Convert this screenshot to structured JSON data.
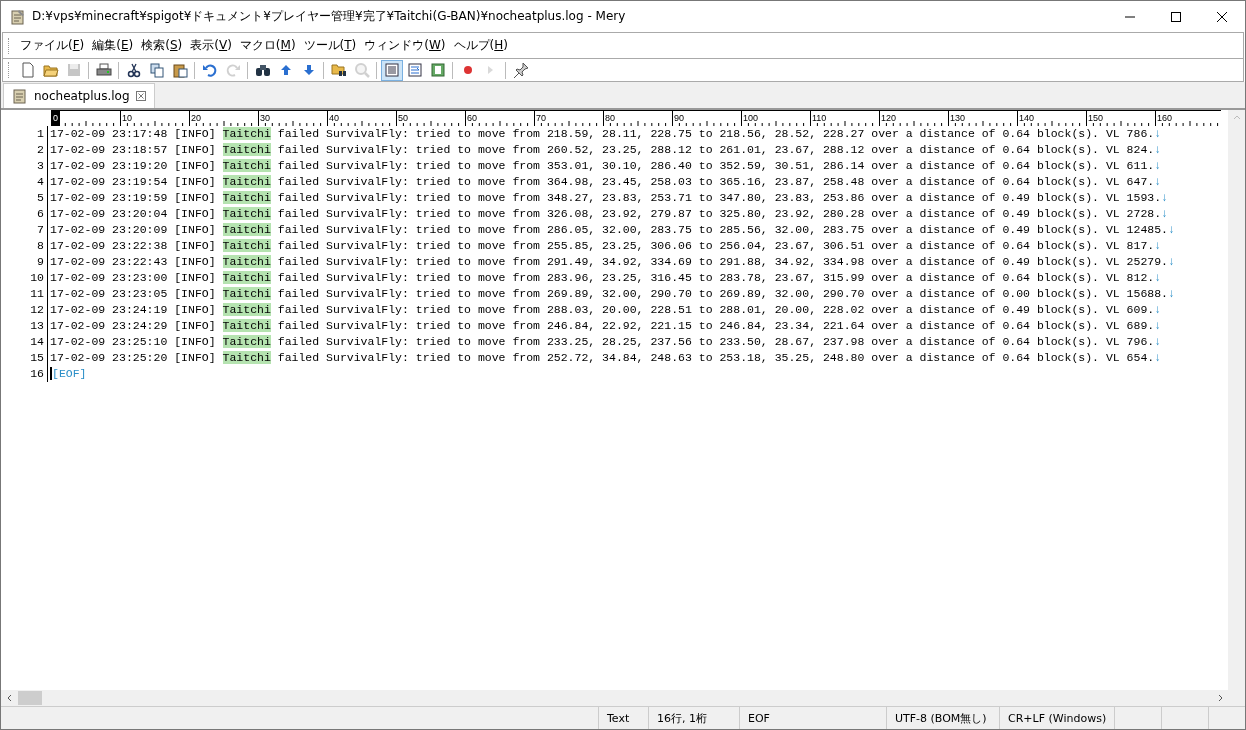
{
  "window": {
    "title": "D:¥vps¥minecraft¥spigot¥ドキュメント¥プレイヤー管理¥完了¥Taitchi(G-BAN)¥nocheatplus.log - Mery"
  },
  "menu": [
    "ファイル(F)",
    "編集(E)",
    "検索(S)",
    "表示(V)",
    "マクロ(M)",
    "ツール(T)",
    "ウィンドウ(W)",
    "ヘルプ(H)"
  ],
  "toolbar": [
    {
      "kind": "new",
      "disabled": false,
      "selected": false
    },
    {
      "kind": "open",
      "disabled": false,
      "selected": false
    },
    {
      "kind": "save",
      "disabled": true,
      "selected": false
    },
    {
      "kind": "separator"
    },
    {
      "kind": "print",
      "disabled": false,
      "selected": false
    },
    {
      "kind": "separator"
    },
    {
      "kind": "cut",
      "disabled": false,
      "selected": false
    },
    {
      "kind": "copy",
      "disabled": false,
      "selected": false
    },
    {
      "kind": "paste",
      "disabled": false,
      "selected": false
    },
    {
      "kind": "separator"
    },
    {
      "kind": "undo",
      "disabled": false,
      "selected": false
    },
    {
      "kind": "redo",
      "disabled": true,
      "selected": false
    },
    {
      "kind": "separator"
    },
    {
      "kind": "find",
      "disabled": false,
      "selected": false
    },
    {
      "kind": "up",
      "disabled": false,
      "selected": false
    },
    {
      "kind": "down",
      "disabled": false,
      "selected": false
    },
    {
      "kind": "separator"
    },
    {
      "kind": "findfiles",
      "disabled": false,
      "selected": false
    },
    {
      "kind": "magnifier",
      "disabled": true,
      "selected": false
    },
    {
      "kind": "separator"
    },
    {
      "kind": "wrapnone",
      "disabled": false,
      "selected": true
    },
    {
      "kind": "wrapwindow",
      "disabled": false,
      "selected": false
    },
    {
      "kind": "wrapcolumn",
      "disabled": false,
      "selected": false
    },
    {
      "kind": "separator"
    },
    {
      "kind": "record",
      "disabled": false,
      "selected": false
    },
    {
      "kind": "play",
      "disabled": true,
      "selected": false
    },
    {
      "kind": "separator"
    },
    {
      "kind": "pin",
      "disabled": false,
      "selected": false
    }
  ],
  "tabs": [
    {
      "label": "nocheatplus.log",
      "selected": true
    }
  ],
  "ruler": [
    "0",
    "10",
    "20",
    "30",
    "40",
    "50",
    "60",
    "70",
    "80",
    "90",
    "100",
    "110",
    "120",
    "130",
    "140",
    "150",
    "160"
  ],
  "lines": [
    {
      "number": "1",
      "head": "17-02-09 23:17:48 [INFO]",
      "match": "Taitchi",
      "rest": "failed SurvivalFly: tried to move from 218.59, 28.11, 228.75 to 218.56, 28.52, 228.27 over a distance of 0.64 block(s). VL 786.",
      "eol": "↓"
    },
    {
      "number": "2",
      "head": "17-02-09 23:18:57 [INFO]",
      "match": "Taitchi",
      "rest": "failed SurvivalFly: tried to move from 260.52, 23.25, 288.12 to 261.01, 23.67, 288.12 over a distance of 0.64 block(s). VL 824.",
      "eol": "↓"
    },
    {
      "number": "3",
      "head": "17-02-09 23:19:20 [INFO]",
      "match": "Taitchi",
      "rest": "failed SurvivalFly: tried to move from 353.01, 30.10, 286.40 to 352.59, 30.51, 286.14 over a distance of 0.64 block(s). VL 611.",
      "eol": "↓"
    },
    {
      "number": "4",
      "head": "17-02-09 23:19:54 [INFO]",
      "match": "Taitchi",
      "rest": "failed SurvivalFly: tried to move from 364.98, 23.45, 258.03 to 365.16, 23.87, 258.48 over a distance of 0.64 block(s). VL 647.",
      "eol": "↓"
    },
    {
      "number": "5",
      "head": "17-02-09 23:19:59 [INFO]",
      "match": "Taitchi",
      "rest": "failed SurvivalFly: tried to move from 348.27, 23.83, 253.71 to 347.80, 23.83, 253.86 over a distance of 0.49 block(s). VL 1593.",
      "eol": "↓"
    },
    {
      "number": "6",
      "head": "17-02-09 23:20:04 [INFO]",
      "match": "Taitchi",
      "rest": "failed SurvivalFly: tried to move from 326.08, 23.92, 279.87 to 325.80, 23.92, 280.28 over a distance of 0.49 block(s). VL 2728.",
      "eol": "↓"
    },
    {
      "number": "7",
      "head": "17-02-09 23:20:09 [INFO]",
      "match": "Taitchi",
      "rest": "failed SurvivalFly: tried to move from 286.05, 32.00, 283.75 to 285.56, 32.00, 283.75 over a distance of 0.49 block(s). VL 12485.",
      "eol": "↓"
    },
    {
      "number": "8",
      "head": "17-02-09 23:22:38 [INFO]",
      "match": "Taitchi",
      "rest": "failed SurvivalFly: tried to move from 255.85, 23.25, 306.06 to 256.04, 23.67, 306.51 over a distance of 0.64 block(s). VL 817.",
      "eol": "↓"
    },
    {
      "number": "9",
      "head": "17-02-09 23:22:43 [INFO]",
      "match": "Taitchi",
      "rest": "failed SurvivalFly: tried to move from 291.49, 34.92, 334.69 to 291.88, 34.92, 334.98 over a distance of 0.49 block(s). VL 25279.",
      "eol": "↓"
    },
    {
      "number": "10",
      "head": "17-02-09 23:23:00 [INFO]",
      "match": "Taitchi",
      "rest": "failed SurvivalFly: tried to move from 283.96, 23.25, 316.45 to 283.78, 23.67, 315.99 over a distance of 0.64 block(s). VL 812.",
      "eol": "↓"
    },
    {
      "number": "11",
      "head": "17-02-09 23:23:05 [INFO]",
      "match": "Taitchi",
      "rest": "failed SurvivalFly: tried to move from 269.89, 32.00, 290.70 to 269.89, 32.00, 290.70 over a distance of 0.00 block(s). VL 15688.",
      "eol": "↓"
    },
    {
      "number": "12",
      "head": "17-02-09 23:24:19 [INFO]",
      "match": "Taitchi",
      "rest": "failed SurvivalFly: tried to move from 288.03, 20.00, 228.51 to 288.01, 20.00, 228.02 over a distance of 0.49 block(s). VL 609.",
      "eol": "↓"
    },
    {
      "number": "13",
      "head": "17-02-09 23:24:29 [INFO]",
      "match": "Taitchi",
      "rest": "failed SurvivalFly: tried to move from 246.84, 22.92, 221.15 to 246.84, 23.34, 221.64 over a distance of 0.64 block(s). VL 689.",
      "eol": "↓"
    },
    {
      "number": "14",
      "head": "17-02-09 23:25:10 [INFO]",
      "match": "Taitchi",
      "rest": "failed SurvivalFly: tried to move from 233.25, 28.25, 237.56 to 233.50, 28.67, 237.98 over a distance of 0.64 block(s). VL 796.",
      "eol": "↓"
    },
    {
      "number": "15",
      "head": "17-02-09 23:25:20 [INFO]",
      "match": "Taitchi",
      "rest": "failed SurvivalFly: tried to move from 252.72, 34.84, 248.63 to 253.18, 35.25, 248.80 over a distance of 0.64 block(s). VL 654.",
      "eol": "↓"
    }
  ],
  "eof_line": {
    "number": "16",
    "marker": "[EOF]"
  },
  "status_bar": [
    "Text",
    "16行, 1桁",
    "EOF",
    "UTF-8 (BOM無し)",
    "CR+LF (Windows)"
  ]
}
